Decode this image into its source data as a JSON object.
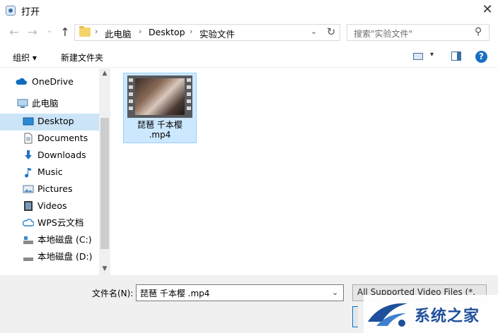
{
  "window": {
    "title": "打开"
  },
  "address": {
    "crumbs": [
      "此电脑",
      "Desktop",
      "实验文件"
    ]
  },
  "search": {
    "placeholder": "搜索\"实验文件\""
  },
  "toolbar": {
    "organize": "组织 ▾",
    "new_folder": "新建文件夹"
  },
  "nav": {
    "items": [
      {
        "label": "OneDrive",
        "icon": "cloud-icon"
      },
      {
        "label": "此电脑",
        "icon": "computer-icon"
      },
      {
        "label": "Desktop",
        "icon": "desktop-icon",
        "selected": true
      },
      {
        "label": "Documents",
        "icon": "document-icon"
      },
      {
        "label": "Downloads",
        "icon": "download-icon"
      },
      {
        "label": "Music",
        "icon": "music-icon"
      },
      {
        "label": "Pictures",
        "icon": "picture-icon"
      },
      {
        "label": "Videos",
        "icon": "video-icon"
      },
      {
        "label": "WPS云文档",
        "icon": "cloud-outline-icon"
      },
      {
        "label": "本地磁盘 (C:)",
        "icon": "drive-icon"
      },
      {
        "label": "本地磁盘 (D:)",
        "icon": "drive-icon"
      }
    ]
  },
  "content": {
    "files": [
      {
        "name_line1": "琵琶 千本樱",
        "name_line2": ".mp4",
        "icon": "video-thumbnail"
      }
    ]
  },
  "footer": {
    "filename_label": "文件名(N):",
    "filename_value": "琵琶 千本樱 .mp4",
    "filter_text": "All Supported Video Files (*."
  },
  "watermark": {
    "text": "系统之家"
  },
  "colors": {
    "selection": "#cce8ff",
    "nav_selected": "#cce4f7",
    "accent": "#0078d7",
    "help": "#1a6fc2"
  }
}
